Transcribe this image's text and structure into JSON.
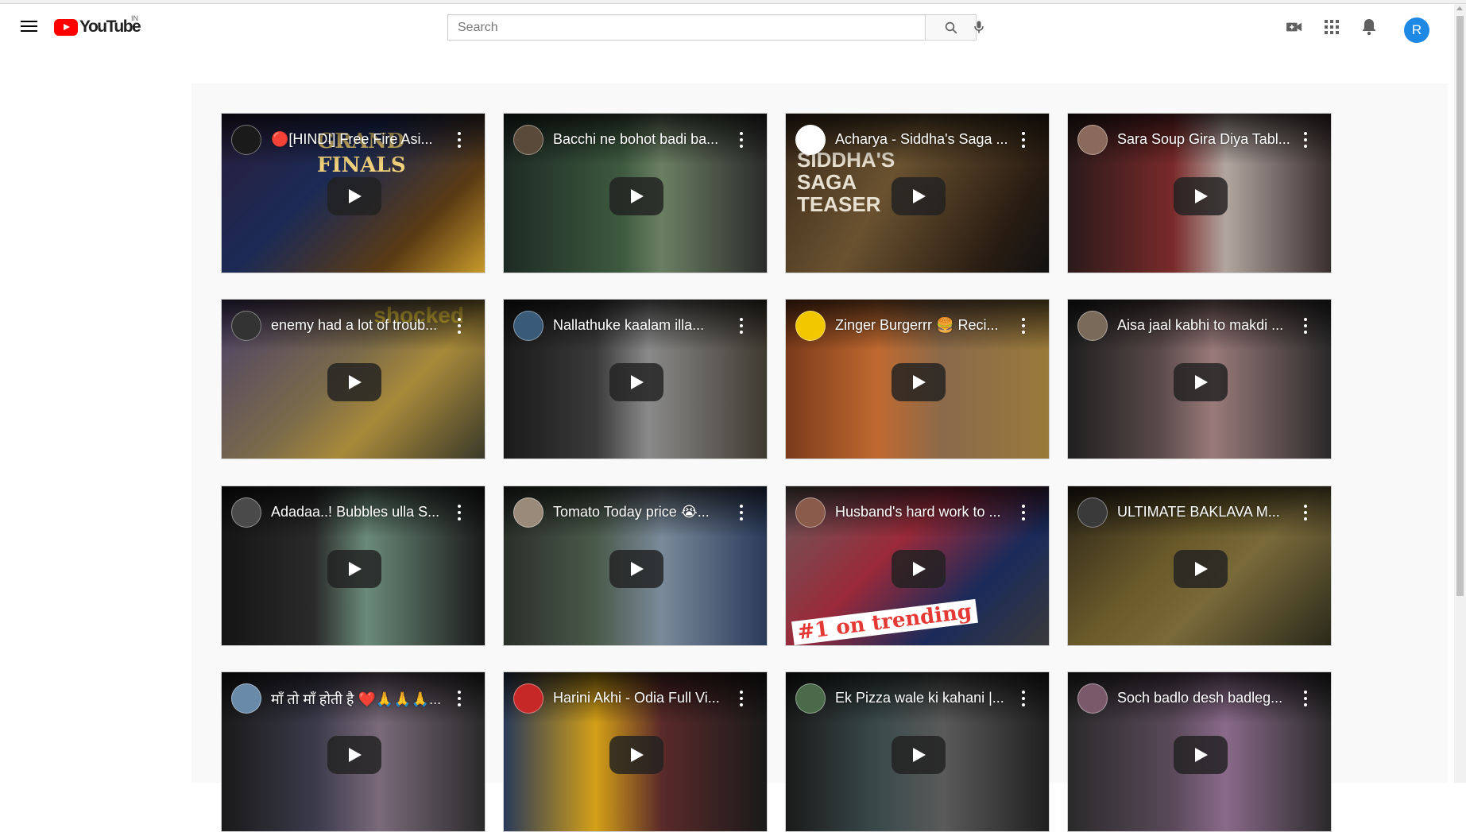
{
  "masthead": {
    "logo_text": "YouTube",
    "country_code": "IN",
    "search_placeholder": "Search",
    "search_value": "",
    "avatar_letter": "R",
    "icons": [
      "menu-icon",
      "search-icon",
      "mic-icon",
      "create-video-icon",
      "apps-icon",
      "notifications-icon"
    ]
  },
  "colors": {
    "brand_red": "#ff0000",
    "avatar_blue": "#1e88e5",
    "content_bg": "#f9f9f9"
  },
  "videos": [
    {
      "title": "🔴[HINDI] Free Fire Asi...",
      "thumb": "linear-gradient(135deg,#2a1d3a 0%,#1b2a55 40%,#5b3b14 75%,#c79a2b 100%)",
      "avatar": "#1a1a1a",
      "overlay": "GRAND FINALS",
      "overlay_color": "#f2d27a"
    },
    {
      "title": "Bacchi ne bohot badi ba...",
      "thumb": "linear-gradient(90deg,#1d2a24 0%,#3d5a3f 45%,#6b7f63 60%,#2b2b2b 100%)",
      "avatar": "#5a4a3a",
      "overlay": "",
      "overlay_color": ""
    },
    {
      "title": "Acharya - Siddha's Saga ...",
      "thumb": "linear-gradient(120deg,#3b2a1a 0%,#6a5230 40%,#2a1d12 80%,#111 100%)",
      "avatar": "#ffffff",
      "overlay": "SIDDHA'S SAGA TEASER",
      "overlay_color": "#e8e0d0"
    },
    {
      "title": "Sara Soup Gira Diya Tabl...",
      "thumb": "linear-gradient(90deg,#2a1a1a 0%,#7a2a2a 40%,#b2a6a0 60%,#3a2f2f 100%)",
      "avatar": "#8a6a5a",
      "overlay": "",
      "overlay_color": ""
    },
    {
      "title": "enemy had a lot of troub...",
      "thumb": "linear-gradient(135deg,#4a3f6a 0%,#7a6a4a 45%,#a88a3a 65%,#3a3a2a 100%)",
      "avatar": "#333333",
      "overlay": "shocked",
      "overlay_color": "#f4d03f"
    },
    {
      "title": "Nallathuke kaalam illa...",
      "thumb": "linear-gradient(90deg,#1a1a1a 0%,#3a3a3a 35%,#8a8a8a 55%,#3f3a30 100%)",
      "avatar": "#3a5a7a",
      "overlay": "",
      "overlay_color": ""
    },
    {
      "title": "Zinger Burgerrr 🍔 Reci...",
      "thumb": "linear-gradient(90deg,#7a3a1a 0%,#c06a30 35%,#8a6a4a 60%,#9a7a3a 100%)",
      "avatar": "#f2c700",
      "overlay": "",
      "overlay_color": ""
    },
    {
      "title": "Aisa jaal kabhi to makdi ...",
      "thumb": "linear-gradient(90deg,#1f1f1f 0%,#5a4a4a 35%,#9a7a7a 55%,#2a2a2a 100%)",
      "avatar": "#7a6a5a",
      "overlay": "",
      "overlay_color": ""
    },
    {
      "title": "Adadaa..! Bubbles ulla S...",
      "thumb": "linear-gradient(90deg,#151515 0%,#2a2a2a 35%,#6a8a7a 55%,#1a1a1a 100%)",
      "avatar": "#4a4a4a",
      "overlay": "",
      "overlay_color": ""
    },
    {
      "title": "Tomato Today price 😭...",
      "thumb": "linear-gradient(90deg,#2a2f2a 0%,#4a5a4a 35%,#7a8a9a 60%,#2a3a5a 100%)",
      "avatar": "#9a8a7a",
      "overlay": "",
      "overlay_color": ""
    },
    {
      "title": "Husband's hard work to ...",
      "thumb": "linear-gradient(135deg,#6a5a5a 0%,#9a2a3a 40%,#1a2a5a 70%,#3a3a3a 100%)",
      "avatar": "#8a5a4a",
      "overlay": "#1 on trending",
      "overlay_color": "#e53935"
    },
    {
      "title": "ULTIMATE BAKLAVA M...",
      "thumb": "linear-gradient(135deg,#2a2418 0%,#6a5a2a 40%,#7a6a3a 60%,#2a2a1a 100%)",
      "avatar": "#3a3a3a",
      "overlay": "",
      "overlay_color": ""
    },
    {
      "title": "माँ तो माँ होती है ❤️🙏🙏🙏...",
      "thumb": "linear-gradient(90deg,#1a1a1a 0%,#3a3a4a 35%,#7a6a7a 60%,#2a2a2a 100%)",
      "avatar": "#6a8aaa",
      "overlay": "",
      "overlay_color": ""
    },
    {
      "title": "Harini Akhi - Odia Full Vi...",
      "thumb": "linear-gradient(90deg,#2a3a5a 0%,#d4a017 35%,#5a2a2a 60%,#1a1a1a 100%)",
      "avatar": "#c62828",
      "overlay": "",
      "overlay_color": ""
    },
    {
      "title": "Ek Pizza wale ki kahani |...",
      "thumb": "linear-gradient(90deg,#1a1a1a 0%,#3a4a4a 35%,#5a5a5a 60%,#1f1f1f 100%)",
      "avatar": "#4a6a4a",
      "overlay": "",
      "overlay_color": ""
    },
    {
      "title": "Soch badlo desh badleg...",
      "thumb": "linear-gradient(90deg,#2a2a2a 0%,#5a4a5a 40%,#8a6a8a 60%,#2a2a2a 100%)",
      "avatar": "#7a5a6a",
      "overlay": "",
      "overlay_color": ""
    }
  ]
}
